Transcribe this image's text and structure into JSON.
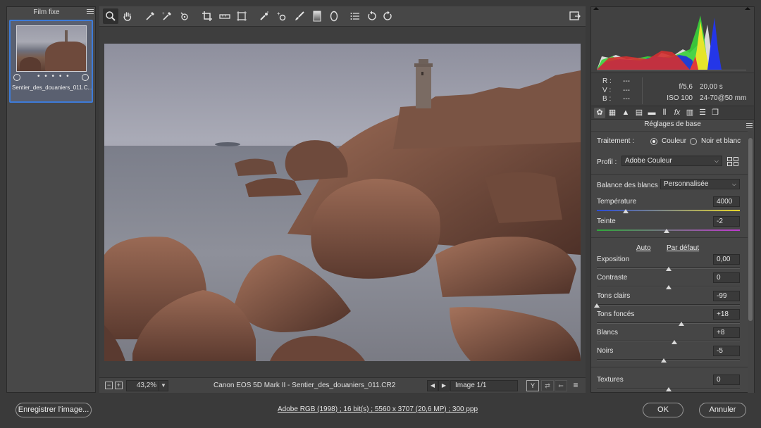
{
  "filmstrip": {
    "title": "Film fixe",
    "thumb_name": "Sentier_des_douaniers_011.C...",
    "thumb_dots": "• • • • •"
  },
  "status": {
    "zoom_minus": "−",
    "zoom_plus": "+",
    "zoom": "43,2%",
    "file_info": "Canon EOS 5D Mark II  -  Sentier_des_douaniers_011.CR2",
    "image_counter": "Image 1/1"
  },
  "exif": {
    "r_label": "R :",
    "v_label": "V :",
    "b_label": "B :",
    "r_value": "---",
    "v_value": "---",
    "b_value": "---",
    "aperture": "f/5,6",
    "shutter": "20,00 s",
    "iso": "ISO 100",
    "lens": "24-70@50 mm"
  },
  "panel": {
    "section_title": "Réglages de base",
    "treatment_label": "Traitement :",
    "color_option": "Couleur",
    "bw_option": "Noir et blanc",
    "profile_label": "Profil :",
    "profile_value": "Adobe Couleur",
    "wb_label": "Balance des blancs :",
    "wb_value": "Personnalisée",
    "auto_link": "Auto",
    "default_link": "Par défaut"
  },
  "sliders": [
    {
      "label": "Température",
      "value": "4000",
      "pos": 0.2
    },
    {
      "label": "Teinte",
      "value": "-2",
      "pos": 0.49
    },
    {
      "label": "Exposition",
      "value": "0,00",
      "pos": 0.5
    },
    {
      "label": "Contraste",
      "value": "0",
      "pos": 0.5
    },
    {
      "label": "Tons clairs",
      "value": "-99",
      "pos": 0.0
    },
    {
      "label": "Tons foncés",
      "value": "+18",
      "pos": 0.59
    },
    {
      "label": "Blancs",
      "value": "+8",
      "pos": 0.54
    },
    {
      "label": "Noirs",
      "value": "-5",
      "pos": 0.47
    },
    {
      "label": "Textures",
      "value": "0",
      "pos": 0.5
    }
  ],
  "footer": {
    "save_label": "Enregistrer l'image...",
    "info": "Adobe RGB (1998) ; 16 bit(s) ; 5560 x 3707 (20,6 MP) ; 300 ppp",
    "ok_label": "OK",
    "cancel_label": "Annuler"
  },
  "colors": {
    "accent": "#3d7bd9",
    "panel": "#464646",
    "background": "#3a3a3a"
  },
  "icons": [
    "zoom-icon",
    "hand-icon",
    "white-balance-icon",
    "color-sampler-icon",
    "target-adjust-icon",
    "crop-icon",
    "straighten-icon",
    "transform-icon",
    "spot-removal-icon",
    "red-eye-icon",
    "adjustment-brush-icon",
    "graduated-filter-icon",
    "radial-filter-icon",
    "list-icon",
    "rotate-left-icon",
    "rotate-right-icon",
    "fullscreen-icon"
  ]
}
